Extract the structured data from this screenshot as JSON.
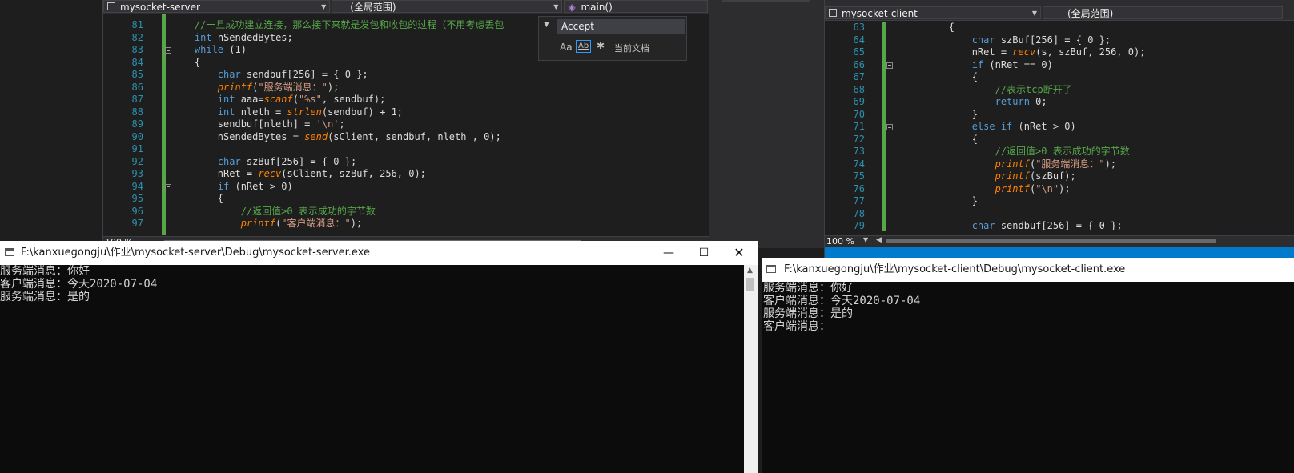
{
  "server_editor": {
    "project": "mysocket-server",
    "scope": "(全局范围)",
    "function": "main()",
    "zoom": "100 %",
    "lines": [
      {
        "n": "81",
        "html": "    <span class='cm'>//一旦成功建立连接，那么接下来就是发包和收包的过程（不用考虑丢包</span>"
      },
      {
        "n": "82",
        "html": "    <span class='kw'>int</span> nSendedBytes;"
      },
      {
        "n": "83",
        "html": "    <span class='kw'>while</span> (1)"
      },
      {
        "n": "84",
        "html": "    {"
      },
      {
        "n": "85",
        "html": "        <span class='kw'>char</span> sendbuf[256] = { 0 };"
      },
      {
        "n": "86",
        "html": "        <span class='fn'>printf</span>(<span class='str'>\"服务端消息：\"</span>);"
      },
      {
        "n": "87",
        "html": "        <span class='kw'>int</span> aaa=<span class='fn'>scanf</span>(<span class='str'>\"%s\"</span>, sendbuf);"
      },
      {
        "n": "88",
        "html": "        <span class='kw'>int</span> nleth = <span class='fn'>strlen</span>(sendbuf) + 1;"
      },
      {
        "n": "89",
        "html": "        sendbuf[nleth] = <span class='str'>'\\n'</span>;"
      },
      {
        "n": "90",
        "html": "        nSendedBytes = <span class='fn'>send</span>(sClient, sendbuf, nleth , 0);"
      },
      {
        "n": "91",
        "html": ""
      },
      {
        "n": "92",
        "html": "        <span class='kw'>char</span> szBuf[256] = { 0 };"
      },
      {
        "n": "93",
        "html": "        nRet = <span class='fn'>recv</span>(sClient, szBuf, 256, 0);"
      },
      {
        "n": "94",
        "html": "        <span class='kw'>if</span> (nRet &gt; 0)"
      },
      {
        "n": "95",
        "html": "        {"
      },
      {
        "n": "96",
        "html": "            <span class='cm'>//返回值&gt;0 表示成功的字节数</span>"
      },
      {
        "n": "97",
        "html": "            <span class='fn'>printf</span>(<span class='str'>\"客户端消息：\"</span>);"
      }
    ]
  },
  "find_widget": {
    "search_text": "Accept",
    "match_case": "Aa",
    "whole_word": "Ab",
    "scope": "当前文档"
  },
  "client_editor": {
    "project": "mysocket-client",
    "scope": "(全局范围)",
    "zoom": "100 %",
    "lines": [
      {
        "n": "63",
        "html": "        {"
      },
      {
        "n": "64",
        "html": "            <span class='kw'>char</span> szBuf[256] = { 0 };"
      },
      {
        "n": "65",
        "html": "            nRet = <span class='fn'>recv</span>(s, szBuf, 256, 0);"
      },
      {
        "n": "66",
        "html": "            <span class='kw'>if</span> (nRet == 0)"
      },
      {
        "n": "67",
        "html": "            {"
      },
      {
        "n": "68",
        "html": "                <span class='cm'>//表示tcp断开了</span>"
      },
      {
        "n": "69",
        "html": "                <span class='kw'>return</span> 0;"
      },
      {
        "n": "70",
        "html": "            }"
      },
      {
        "n": "71",
        "html": "            <span class='kw'>else if</span> (nRet &gt; 0)"
      },
      {
        "n": "72",
        "html": "            {"
      },
      {
        "n": "73",
        "html": "                <span class='cm'>//返回值&gt;0 表示成功的字节数</span>"
      },
      {
        "n": "74",
        "html": "                <span class='fn'>printf</span>(<span class='str'>\"服务端消息：\"</span>);"
      },
      {
        "n": "75",
        "html": "                <span class='fn'>printf</span>(szBuf);"
      },
      {
        "n": "76",
        "html": "                <span class='fn'>printf</span>(<span class='str'>\"\\n\"</span>);"
      },
      {
        "n": "77",
        "html": "            }"
      },
      {
        "n": "78",
        "html": ""
      },
      {
        "n": "79",
        "html": "            <span class='kw'>char</span> sendbuf[256] = { 0 };"
      }
    ]
  },
  "server_console": {
    "title": "F:\\kanxuegongju\\作业\\mysocket-server\\Debug\\mysocket-server.exe",
    "output": "服务端消息：你好\n客户端消息：今天2020-07-04\n服务端消息：是的"
  },
  "client_console": {
    "title": "F:\\kanxuegongju\\作业\\mysocket-client\\Debug\\mysocket-client.exe",
    "output": "服务端消息：你好\n客户端消息：今天2020-07-04\n服务端消息：是的\n客户端消息："
  },
  "colors": {
    "keyword": "#569cd6",
    "function": "#ff8000",
    "string": "#d69d85",
    "comment": "#57a64a",
    "line_number": "#2b91af"
  }
}
